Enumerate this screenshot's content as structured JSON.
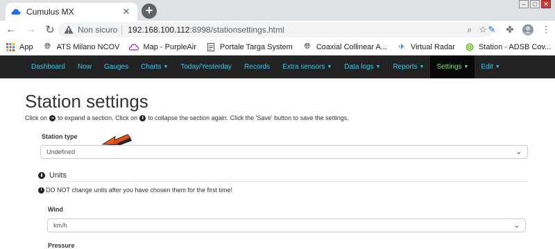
{
  "browser": {
    "tab_title": "Cumulus MX",
    "insecure_label": "Non sicuro",
    "url_host": "192.168.100.112",
    "url_path": ":8998/stationsettings.html"
  },
  "bookmarks": [
    {
      "label": "App",
      "icon": "apps-grid-icon"
    },
    {
      "label": "ATS Milano NCOV",
      "icon": "globe-icon"
    },
    {
      "label": "Map - PurpleAir",
      "icon": "cloud-icon"
    },
    {
      "label": "Portale Targa System",
      "icon": "document-icon"
    },
    {
      "label": "Coaxial Collinear A...",
      "icon": "globe-icon"
    },
    {
      "label": "Virtual Radar",
      "icon": "plane-icon"
    },
    {
      "label": "Station - ADSB Cov...",
      "icon": "radar-icon"
    }
  ],
  "nav": {
    "items": [
      {
        "label": "Dashboard"
      },
      {
        "label": "Now"
      },
      {
        "label": "Gauges"
      },
      {
        "label": "Charts",
        "dropdown": true
      },
      {
        "label": "Today/Yesterday"
      },
      {
        "label": "Records"
      },
      {
        "label": "Extra sensors",
        "dropdown": true
      },
      {
        "label": "Data logs",
        "dropdown": true
      },
      {
        "label": "Reports",
        "dropdown": true
      },
      {
        "label": "Settings",
        "dropdown": true,
        "active": true
      },
      {
        "label": "Edit",
        "dropdown": true
      }
    ]
  },
  "page": {
    "title": "Station settings",
    "intro_a": "Click on",
    "intro_b": "to expand a section. Click on",
    "intro_c": "to collapse the section again. Click the 'Save' button to save the settings.",
    "station_type_label": "Station type",
    "station_type_value": "Undefined",
    "units_heading": "Units",
    "units_warning": "DO NOT change units after you have chosen them for the first time!",
    "wind_label": "Wind",
    "wind_value": "km/h",
    "pressure_label": "Pressure"
  },
  "colors": {
    "nav_bg": "#222222",
    "nav_link": "#3bc8f0",
    "nav_active": "#7ce07c",
    "arrow_red": "#d81c12",
    "arrow_yellow": "#f7c520"
  }
}
